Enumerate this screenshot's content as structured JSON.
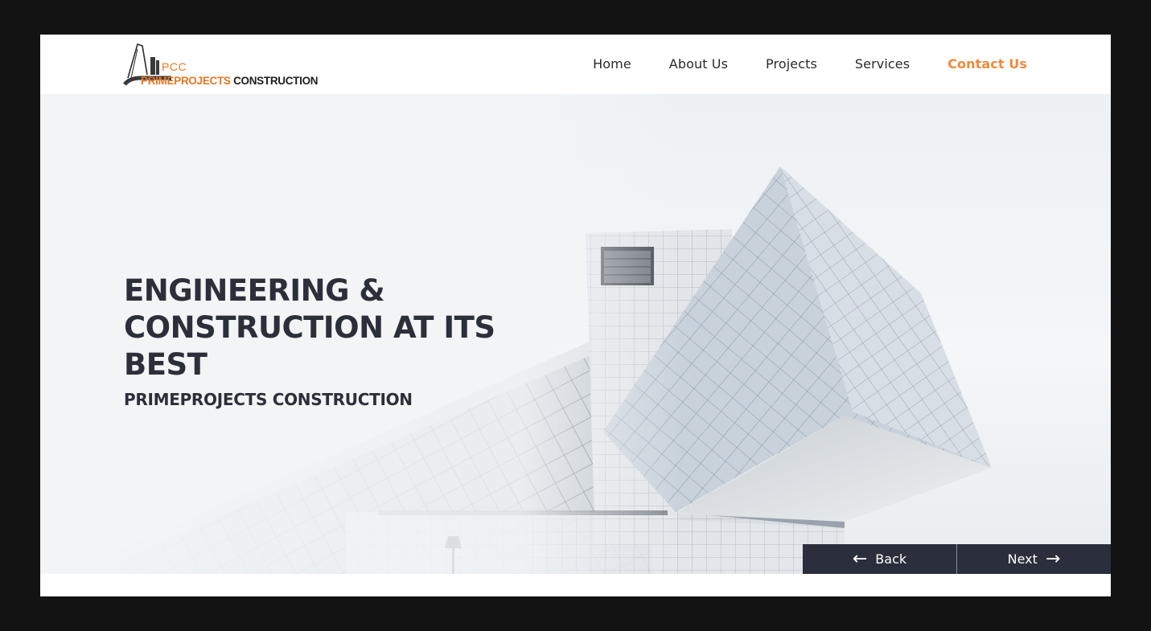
{
  "brand": {
    "logo_abbr": "PCC",
    "logo_name_part1": "PRIMEPROJECTS",
    "logo_name_part2": "CONSTRUCTION",
    "accent_color": "#e87722"
  },
  "nav": {
    "items": [
      {
        "label": "Home",
        "active": false
      },
      {
        "label": "About Us",
        "active": false
      },
      {
        "label": "Projects",
        "active": false
      },
      {
        "label": "Services",
        "active": false
      },
      {
        "label": "Contact Us",
        "active": true
      }
    ],
    "active_color": "#f0893a"
  },
  "hero": {
    "title": "ENGINEERING & CONSTRUCTION AT ITS BEST",
    "subtitle": "PRIMEPROJECTS CONSTRUCTION"
  },
  "slider": {
    "back_label": "Back",
    "next_label": "Next",
    "back_icon": "arrow-left-icon",
    "next_icon": "arrow-right-icon",
    "button_color": "#2b2f3b"
  }
}
